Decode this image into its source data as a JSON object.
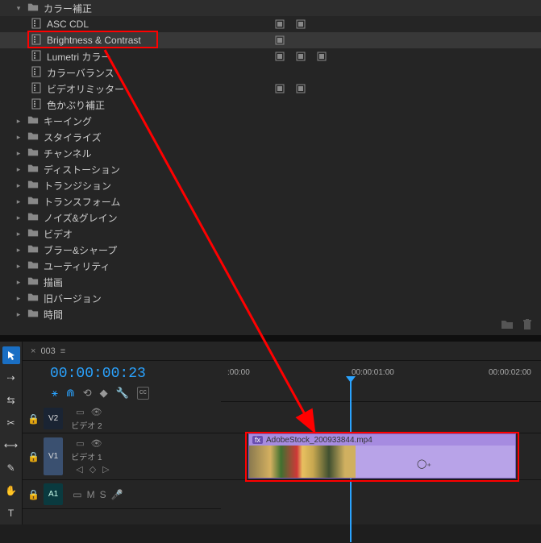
{
  "effects": {
    "groupOpen": "カラー補正",
    "items": [
      {
        "label": "ASC CDL",
        "icons": 2
      },
      {
        "label": "Brightness & Contrast",
        "icons": 1,
        "selected": true
      },
      {
        "label": "Lumetri カラー",
        "icons": 3
      },
      {
        "label": "カラーバランス",
        "icons": 0
      },
      {
        "label": "ビデオリミッター",
        "icons": 2
      },
      {
        "label": "色かぶり補正",
        "icons": 0
      }
    ],
    "folders": [
      "キーイング",
      "スタイライズ",
      "チャンネル",
      "ディストーション",
      "トランジション",
      "トランスフォーム",
      "ノイズ&グレイン",
      "ビデオ",
      "ブラー&シャープ",
      "ユーティリティ",
      "描画",
      "旧バージョン",
      "時間"
    ]
  },
  "timeline": {
    "seqName": "003",
    "timecode": "00:00:00:23",
    "ruler": [
      ":00:00",
      "00:00:01:00",
      "00:00:02:00"
    ],
    "tracks": {
      "v2": {
        "badge": "V2",
        "name": "ビデオ 2"
      },
      "v1": {
        "badge": "V1",
        "name": "ビデオ 1"
      },
      "a1": {
        "badge": "A1",
        "m": "M",
        "s": "S"
      }
    },
    "clip": {
      "name": "AdobeStock_200933844.mp4",
      "fx": "fx"
    }
  }
}
